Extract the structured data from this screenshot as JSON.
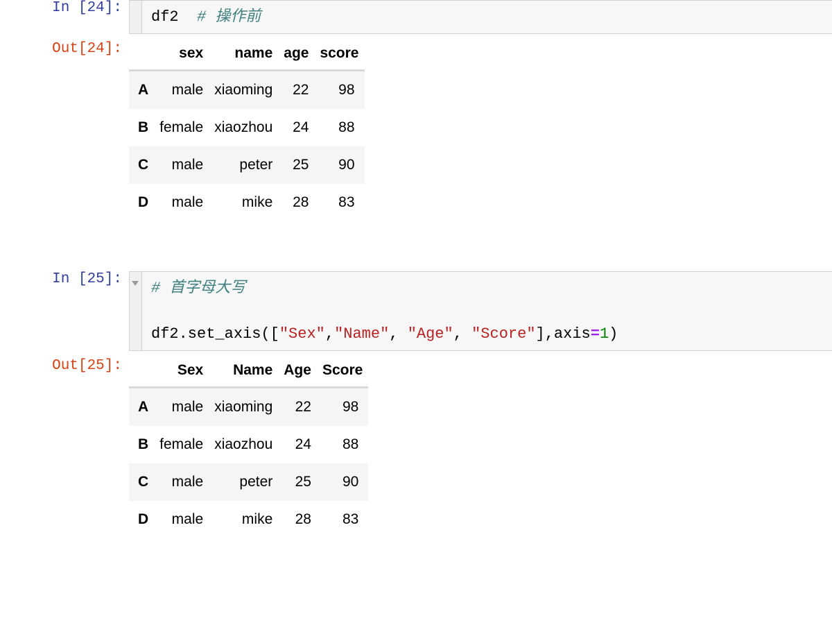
{
  "cells": [
    {
      "type": "code",
      "prompt_in": "In [24]:",
      "prompt_out": "Out[24]:",
      "has_collapser": false,
      "code_tokens": [
        [
          {
            "text": "df2",
            "tok": "plain"
          },
          {
            "text": "  ",
            "tok": "plain"
          },
          {
            "text": "# 操作前",
            "tok": "comment"
          }
        ]
      ],
      "output_table": {
        "index_header": "",
        "columns": [
          "sex",
          "name",
          "age",
          "score"
        ],
        "index": [
          "A",
          "B",
          "C",
          "D"
        ],
        "rows": [
          [
            "male",
            "xiaoming",
            "22",
            "98"
          ],
          [
            "female",
            "xiaozhou",
            "24",
            "88"
          ],
          [
            "male",
            "peter",
            "25",
            "90"
          ],
          [
            "male",
            "mike",
            "28",
            "83"
          ]
        ]
      }
    },
    {
      "type": "code",
      "prompt_in": "In [25]:",
      "prompt_out": "Out[25]:",
      "has_collapser": true,
      "code_tokens": [
        [
          {
            "text": "# 首字母大写",
            "tok": "comment"
          }
        ],
        [],
        [
          {
            "text": "df2.set_axis([",
            "tok": "plain"
          },
          {
            "text": "\"Sex\"",
            "tok": "string"
          },
          {
            "text": ",",
            "tok": "plain"
          },
          {
            "text": "\"Name\"",
            "tok": "string"
          },
          {
            "text": ", ",
            "tok": "plain"
          },
          {
            "text": "\"Age\"",
            "tok": "string"
          },
          {
            "text": ", ",
            "tok": "plain"
          },
          {
            "text": "\"Score\"",
            "tok": "string"
          },
          {
            "text": "],axis",
            "tok": "plain"
          },
          {
            "text": "=",
            "tok": "op"
          },
          {
            "text": "1",
            "tok": "num"
          },
          {
            "text": ")",
            "tok": "plain"
          }
        ]
      ],
      "output_table": {
        "index_header": "",
        "columns": [
          "Sex",
          "Name",
          "Age",
          "Score"
        ],
        "index": [
          "A",
          "B",
          "C",
          "D"
        ],
        "rows": [
          [
            "male",
            "xiaoming",
            "22",
            "98"
          ],
          [
            "female",
            "xiaozhou",
            "24",
            "88"
          ],
          [
            "male",
            "peter",
            "25",
            "90"
          ],
          [
            "male",
            "mike",
            "28",
            "83"
          ]
        ]
      }
    }
  ],
  "colors": {
    "prompt_in": "#303F9F",
    "prompt_out": "#D84315",
    "comment": "#408080",
    "string": "#BA2121",
    "operator": "#A020F0",
    "number": "#008000",
    "cell_bg": "#f7f7f7",
    "cell_border": "#cfcfcf",
    "row_stripe": "#f5f5f5",
    "table_rule": "#d9d9d9"
  },
  "icons": {
    "collapse_triangle": "collapse-triangle-icon"
  }
}
